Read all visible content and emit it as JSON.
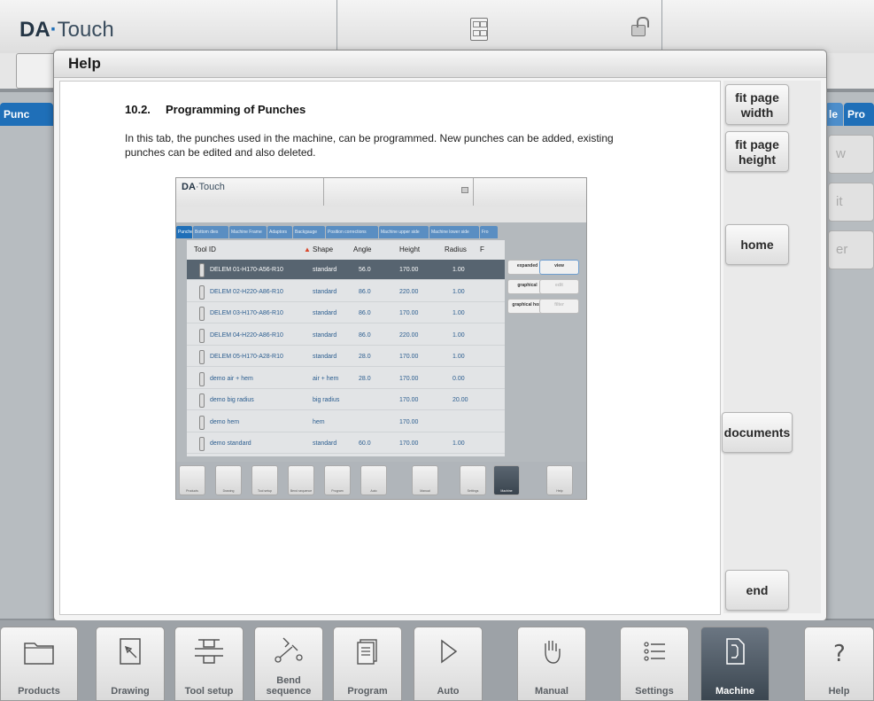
{
  "app": {
    "logo_da": "DA",
    "logo_dot": "·",
    "logo_rest": "Touch",
    "bg_tab_left": "Punc",
    "bg_tab_right1": "le",
    "bg_tab_right2": "Pro",
    "bg_btn1": "w",
    "bg_btn2": "it",
    "bg_btn3": "er"
  },
  "help": {
    "title": "Help",
    "section_number": "10.2.",
    "section_title": "Programming of Punches",
    "paragraph": "In this tab, the punches used in the machine, can be programmed. New punches can be added, existing punches can be edited and also deleted.",
    "buttons": {
      "fit_width": "fit page width",
      "fit_height": "fit page height",
      "home": "home",
      "documents": "documents",
      "end": "end"
    }
  },
  "screenshot": {
    "logo_da": "DA",
    "logo_rest": "·Touch",
    "tabs": [
      "Punches",
      "Bottom dies",
      "Machine Frame",
      "Adaptors",
      "Backgauge",
      "Position corrections",
      "Machine upper side",
      "Machine lower side",
      "Fro"
    ],
    "columns": [
      "Tool ID",
      "Shape",
      "Angle",
      "Height",
      "Radius",
      "F"
    ],
    "rows": [
      {
        "id": "DELEM 01-H170-A56-R10",
        "shape": "standard",
        "angle": "56.0",
        "height": "170.00",
        "radius": "1.00"
      },
      {
        "id": "DELEM 02-H220-A86-R10",
        "shape": "standard",
        "angle": "86.0",
        "height": "220.00",
        "radius": "1.00"
      },
      {
        "id": "DELEM 03-H170-A86-R10",
        "shape": "standard",
        "angle": "86.0",
        "height": "170.00",
        "radius": "1.00"
      },
      {
        "id": "DELEM 04-H220-A86-R10",
        "shape": "standard",
        "angle": "86.0",
        "height": "220.00",
        "radius": "1.00"
      },
      {
        "id": "DELEM 05-H170-A28-R10",
        "shape": "standard",
        "angle": "28.0",
        "height": "170.00",
        "radius": "1.00"
      },
      {
        "id": "demo air + hem",
        "shape": "air + hem",
        "angle": "28.0",
        "height": "170.00",
        "radius": "0.00"
      },
      {
        "id": "demo big radius",
        "shape": "big radius",
        "angle": "",
        "height": "170.00",
        "radius": "20.00"
      },
      {
        "id": "demo hem",
        "shape": "hem",
        "angle": "",
        "height": "170.00",
        "radius": ""
      },
      {
        "id": "demo standard",
        "shape": "standard",
        "angle": "60.0",
        "height": "170.00",
        "radius": "1.00"
      }
    ],
    "side_buttons": [
      "expanded",
      "view",
      "graphical",
      "edit",
      "graphical host",
      "filter"
    ],
    "nav": [
      "Products",
      "Drawing",
      "Tool setup",
      "Bend sequence",
      "Program",
      "Auto",
      "Manual",
      "Settings",
      "Machine",
      "Help"
    ]
  },
  "nav": {
    "products": "Products",
    "drawing": "Drawing",
    "tool_setup": "Tool setup",
    "bend_top": "Bend",
    "bend_bottom": "sequence",
    "program": "Program",
    "auto": "Auto",
    "manual": "Manual",
    "settings": "Settings",
    "machine": "Machine",
    "help": "Help"
  }
}
